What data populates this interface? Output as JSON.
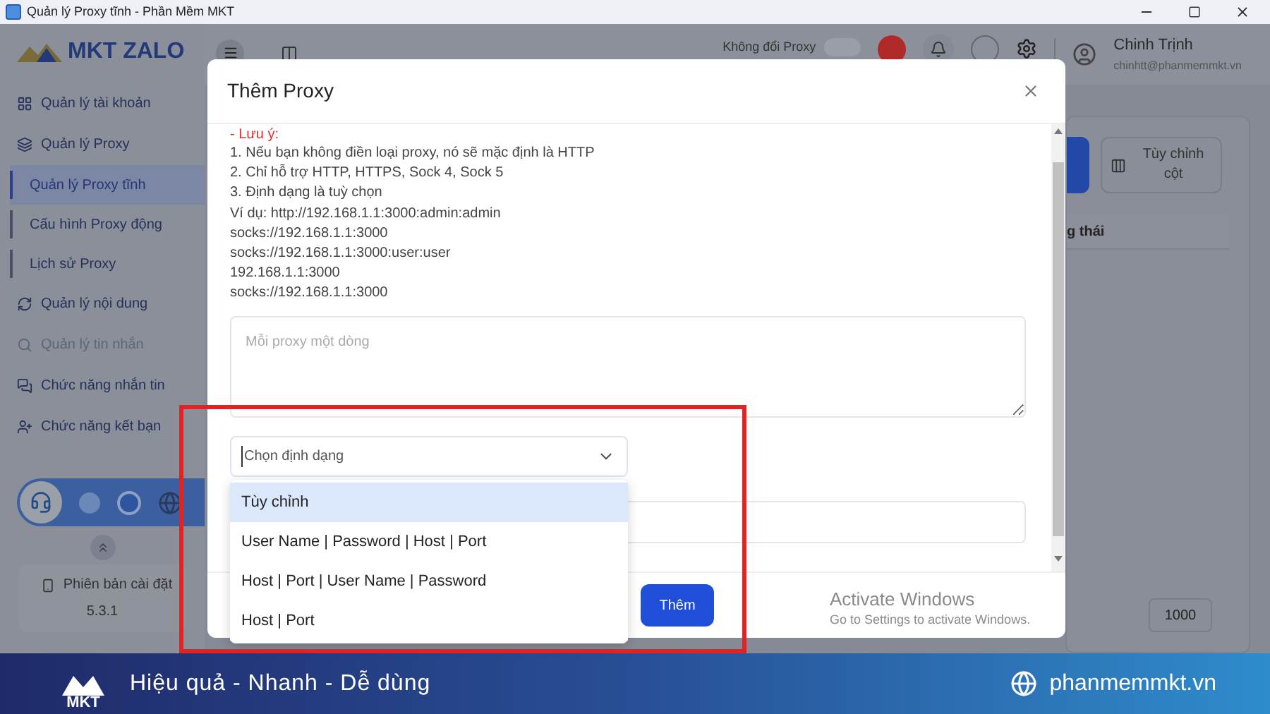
{
  "window": {
    "title": "Quản lý Proxy tĩnh - Phần Mềm MKT"
  },
  "app": {
    "logo": "MKT ZALO"
  },
  "sidebar": {
    "items": [
      {
        "label": "Quản lý tài khoản",
        "selected": false,
        "disabled": false
      },
      {
        "label": "Quản lý Proxy",
        "selected": false,
        "disabled": false,
        "children": [
          {
            "label": "Quản lý Proxy tĩnh",
            "selected": true
          },
          {
            "label": "Cấu hình Proxy động",
            "selected": false
          },
          {
            "label": "Lịch sử Proxy",
            "selected": false
          }
        ]
      },
      {
        "label": "Quản lý nội dung",
        "selected": false,
        "disabled": false
      },
      {
        "label": "Quản lý tin nhắn",
        "selected": false,
        "disabled": true
      },
      {
        "label": "Chức năng nhắn tin",
        "selected": false,
        "disabled": false
      },
      {
        "label": "Chức năng kết bạn",
        "selected": false,
        "disabled": false
      }
    ]
  },
  "version": {
    "label": "Phiên bản cài đặt",
    "number": "5.3.1"
  },
  "header": {
    "proxy_toggle": {
      "label": "Không đổi Proxy",
      "on": false
    },
    "user": {
      "name": "Chinh Trịnh",
      "email": "chinhtt@phanmemmkt.vn"
    }
  },
  "content": {
    "customize_button": "Tùy chỉnh cột",
    "column_header": "g thái",
    "page_size": "1000"
  },
  "dialog": {
    "title": "Thêm Proxy",
    "note_heading": "- Lưu ý:",
    "note_lines": [
      "1. Nếu bạn không điền loại proxy, nó sẽ mặc định là HTTP",
      "2. Chỉ hỗ trợ HTTP, HTTPS, Sock 4, Sock 5",
      "3. Định dạng là tuỳ chọn",
      "Ví dụ: http://192.168.1.1:3000:admin:admin",
      "socks://192.168.1.1:3000",
      "socks://192.168.1.1:3000:user:user",
      "192.168.1.1:3000",
      "socks://192.168.1.1:3000"
    ],
    "proxy_input": {
      "placeholder": "Mỗi proxy một dòng"
    },
    "format_select": {
      "placeholder": "Chọn định dạng",
      "expanded": true,
      "options": [
        {
          "label": "Tùy chỉnh",
          "selected": true
        },
        {
          "label": "User Name | Password | Host | Port",
          "selected": false
        },
        {
          "label": "Host | Port | User Name | Password",
          "selected": false
        },
        {
          "label": "Host | Port",
          "selected": false
        }
      ]
    },
    "submit_button": "Thêm"
  },
  "os_notice": {
    "title": "Activate Windows",
    "subtitle": "Go to Settings to activate Windows."
  },
  "banner": {
    "logo": "MKT",
    "slogan": "Hiệu quả - Nhanh - Dễ dùng",
    "website": "phanmemmkt.vn"
  }
}
